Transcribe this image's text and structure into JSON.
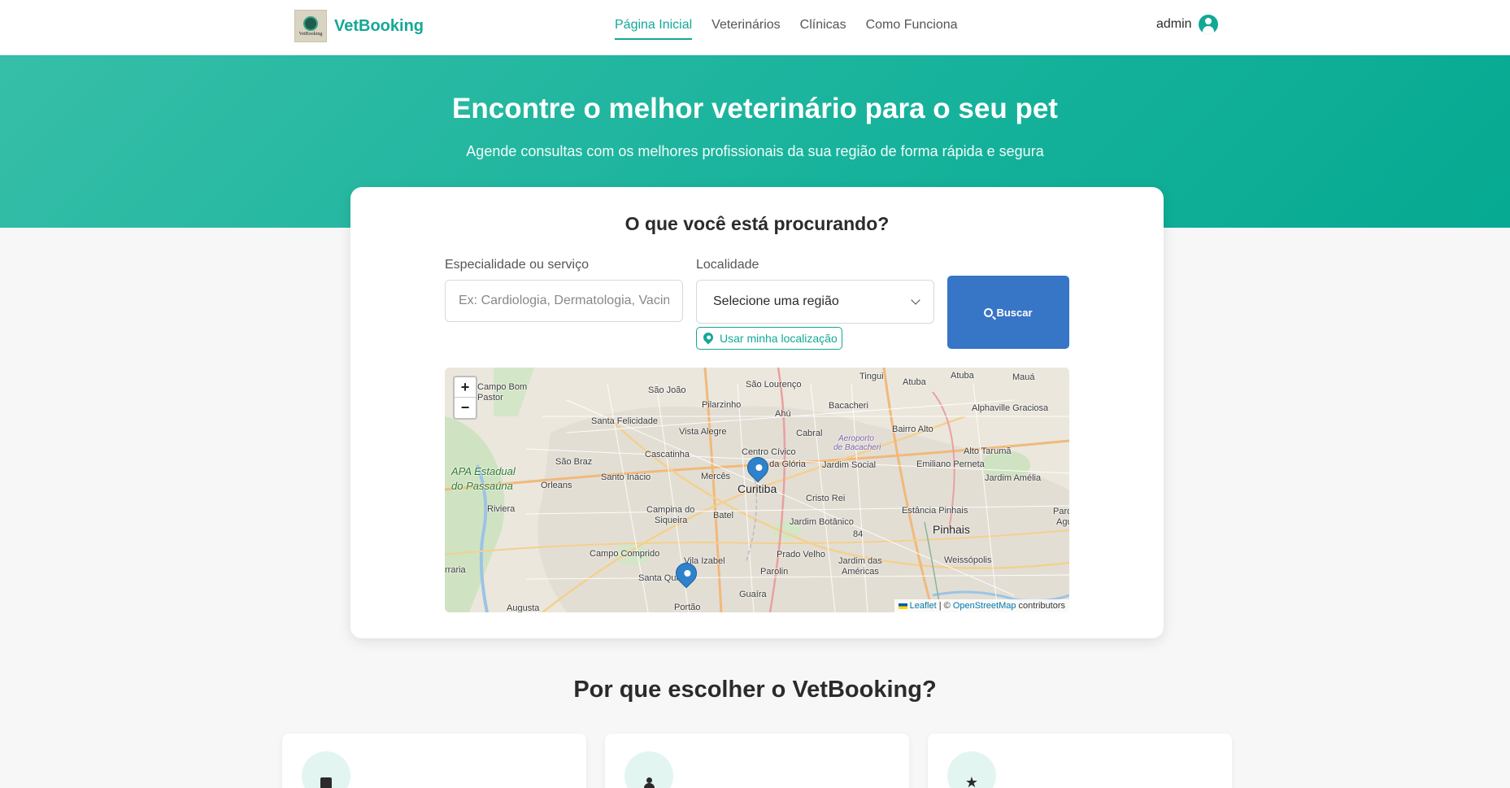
{
  "brand": {
    "logo_text": "VetBooking",
    "name": "VetBooking"
  },
  "nav": {
    "links": [
      {
        "label": "Página Inicial",
        "active": true
      },
      {
        "label": "Veterinários",
        "active": false
      },
      {
        "label": "Clínicas",
        "active": false
      },
      {
        "label": "Como Funciona",
        "active": false
      }
    ],
    "user": "admin",
    "user_icon": "user-circle-icon"
  },
  "hero": {
    "title": "Encontre o melhor veterinário para o seu pet",
    "subtitle": "Agende consultas com os melhores profissionais da sua região de forma rápida e segura"
  },
  "search": {
    "title": "O que você está procurando?",
    "specialty_label": "Especialidade ou serviço",
    "specialty_placeholder": "Ex: Cardiologia, Dermatologia, Vacinação",
    "location_label": "Localidade",
    "location_selected": "Selecione uma região",
    "use_location_label": "Usar minha localização",
    "search_button": "Buscar"
  },
  "map": {
    "zoom_in": "+",
    "zoom_out": "−",
    "attribution": {
      "leaflet": "Leaflet",
      "separator": " | © ",
      "osm": "OpenStreetMap",
      "suffix": " contributors"
    },
    "labels": {
      "campo_bom": "Campo Bom",
      "pastor": "Pastor",
      "sao_joao": "São João",
      "sao_lourenco": "São Lourenço",
      "tingui": "Tingui",
      "atuba1": "Atuba",
      "atuba2": "Atuba",
      "maua": "Mauá",
      "pilarzinho": "Pilarzinho",
      "bacacheri": "Bacacheri",
      "santa_felicidade": "Santa Felicidade",
      "ahu": "Ahú",
      "alphaville": "Alphaville Graciosa",
      "aeroporto1": "Aeroporto",
      "aeroporto2": "de Bacacheri",
      "vista_alegre": "Vista Alegre",
      "cabral": "Cabral",
      "bairro_alto": "Bairro Alto",
      "cascatinha": "Cascatinha",
      "centro_civico": "Centro Cívico",
      "alto_taruma": "Alto Tarumã",
      "sao_braz": "São Braz",
      "gloria": "o da Glória",
      "jardim_social": "Jardim Social",
      "emiliano": "Emiliano Perneta",
      "apa1": "APA Estadual",
      "apa2": "do Passaúna",
      "santo_inacio": "Santo Inácio",
      "merces": "Mercês",
      "jardim_amelia": "Jardim Amélia",
      "orleans": "Orleans",
      "curitiba": "Curitiba",
      "cristo_rei": "Cristo Rei",
      "riviera": "Riviera",
      "campina1": "Campina do",
      "campina2": "Siqueira",
      "estancia": "Estância Pinhais",
      "parque": "Parqu",
      "batel": "Batel",
      "jardim_botanico": "Jardim Botânico",
      "pinhais": "Pinhais",
      "agu": "Agu",
      "road84": "84",
      "campo_comprido": "Campo Comprido",
      "vila_izabel": "Vila Izabel",
      "prado_velho": "Prado Velho",
      "weissopolis": "Weissópolis",
      "jardim_das1": "Jardim das",
      "jardim_das2": "Américas",
      "rraria": "rraria",
      "parolin": "Parolin",
      "santa_quiteria": "Santa Qui",
      "guaira": "Guaíra",
      "augusta": "Augusta",
      "portao": "Portão"
    }
  },
  "why": {
    "title": "Por que escolher o VetBooking?",
    "features": [
      {
        "icon": "calendar-check-icon"
      },
      {
        "icon": "user-doctor-icon"
      },
      {
        "icon": "star-icon",
        "glyph": "★"
      }
    ]
  },
  "colors": {
    "brand": "#13a896",
    "button": "#3775c6"
  }
}
